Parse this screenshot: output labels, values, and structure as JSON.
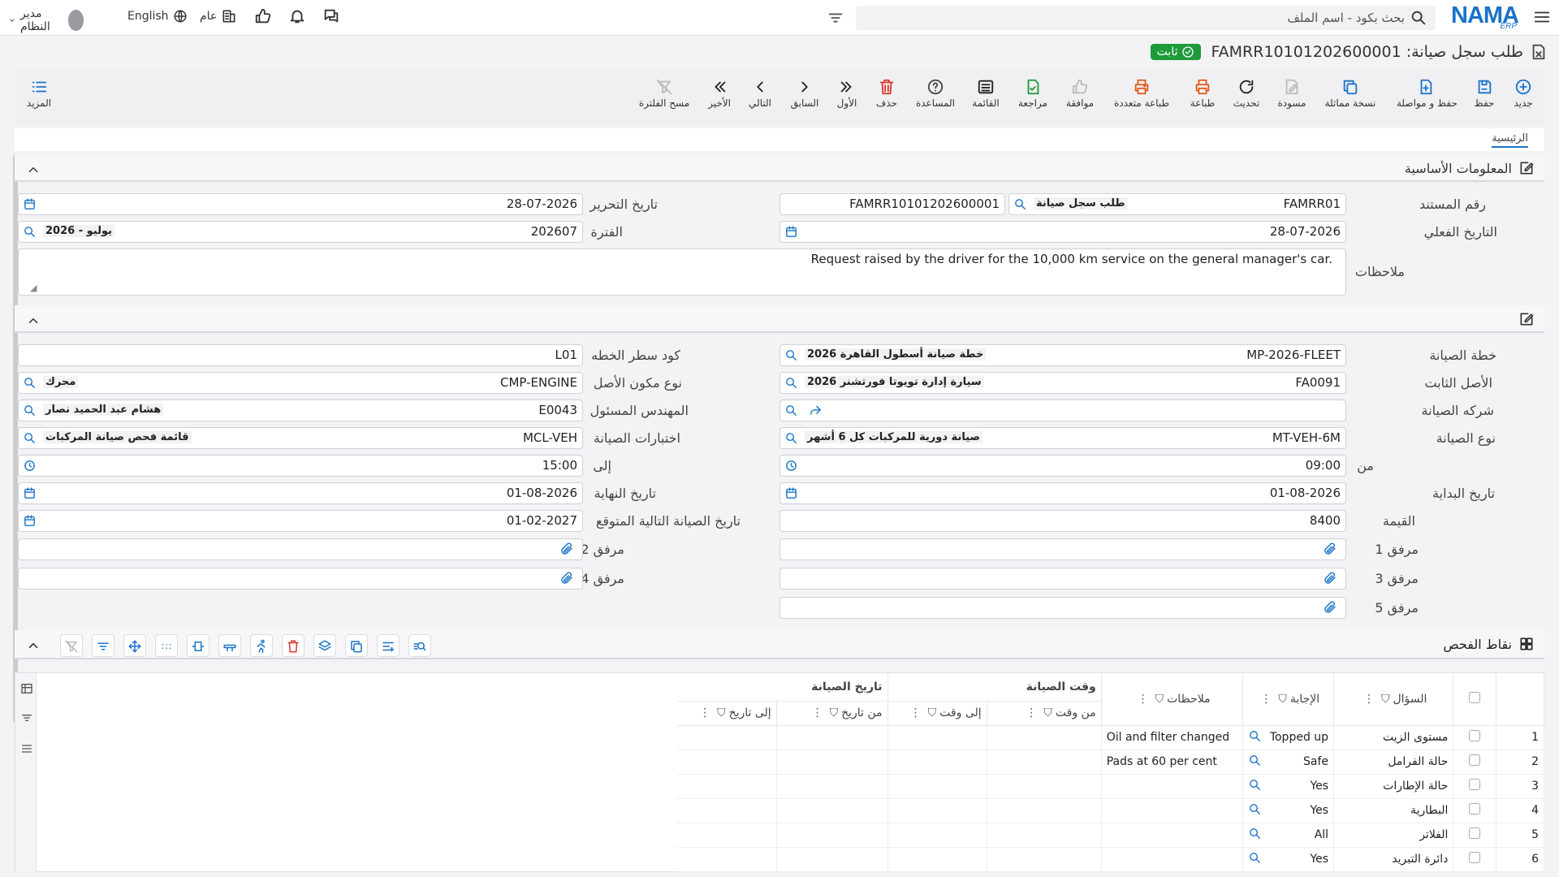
{
  "topbar": {
    "search_placeholder": "بحث بكود - اسم الملف",
    "logo_main": "NAMA",
    "logo_sub": "ERP",
    "user": "مدير النظام",
    "language": "English",
    "scope": "عام"
  },
  "title": {
    "text": "طلب سجل صيانة: FAMRR10101202600001",
    "status": "ثابت"
  },
  "toolbar": [
    {
      "label": "جديد",
      "icon": "plus-circle-icon"
    },
    {
      "label": "حفظ",
      "icon": "save-icon"
    },
    {
      "label": "حفظ و مواصلة",
      "icon": "save-continue-icon"
    },
    {
      "label": "نسخة مماثلة",
      "icon": "copy-icon"
    },
    {
      "label": "مسودة",
      "icon": "draft-icon"
    },
    {
      "label": "تحديث",
      "icon": "refresh-icon"
    },
    {
      "label": "طباعة",
      "icon": "print-icon"
    },
    {
      "label": "طباعة متعددة",
      "icon": "multi-print-icon"
    },
    {
      "label": "موافقة",
      "icon": "thumbs-up-icon"
    },
    {
      "label": "مراجعة",
      "icon": "review-icon"
    },
    {
      "label": "القائمة",
      "icon": "list-icon"
    },
    {
      "label": "المساعدة",
      "icon": "help-icon"
    },
    {
      "label": "حذف",
      "icon": "trash-icon"
    },
    {
      "label": "الأول",
      "icon": "first-icon"
    },
    {
      "label": "السابق",
      "icon": "previous-icon"
    },
    {
      "label": "التالي",
      "icon": "next-icon"
    },
    {
      "label": "الأخير",
      "icon": "last-icon"
    },
    {
      "label": "مسح الفلترة",
      "icon": "clear-filter-icon"
    }
  ],
  "more_label": "المزيد",
  "tab_main": "الرئيسية",
  "section_basic": "المعلومات الأساسية",
  "basic": {
    "doc_no_label": "رقم المستند",
    "doc_no": "FAMRR01",
    "doc_type": "طلب سجل صيانة",
    "doc_code": "FAMRR10101202600001",
    "issue_date_label": "تاريخ التحرير",
    "issue_date": "28-07-2026",
    "actual_date_label": "التاريخ الفعلي",
    "actual_date": "28-07-2026",
    "period_label": "الفترة",
    "period": "202607",
    "period_desc": "2026 - يوليو",
    "notes_label": "ملاحظات",
    "notes": "Request raised by the driver for the 10,000 km service on the general manager's car."
  },
  "details": {
    "plan_label": "خطة الصيانة",
    "plan": "MP-2026-FLEET",
    "plan_desc": "خطة صيانة أسطول القاهرة 2026",
    "plan_line_label": "كود سطر الخطه",
    "plan_line": "L01",
    "asset_label": "الأصل الثابت",
    "asset": "FA0091",
    "asset_desc": "سيارة إدارة تويوتا فورتشنر 2026",
    "component_label": "نوع مكون الأصل",
    "component": "CMP-ENGINE",
    "component_desc": "محرك",
    "company_label": "شركه الصيانة",
    "engineer_label": "المهندس المسئول",
    "engineer": "E0043",
    "engineer_desc": "هشام عبد الحميد نصار",
    "mtype_label": "نوع الصيانة",
    "mtype": "MT-VEH-6M",
    "mtype_desc": "صيانة دورية للمركبات كل 6 أشهر",
    "tests_label": "اختبارات الصيانة",
    "tests": "MCL-VEH",
    "tests_desc": "قائمة فحص صيانة المركبات",
    "from_label": "من",
    "from": "09:00",
    "to_label": "إلى",
    "to": "15:00",
    "start_label": "تاريخ البداية",
    "start": "01-08-2026",
    "end_label": "تاريخ النهاية",
    "end": "01-08-2026",
    "value_label": "القيمة",
    "value": "8400",
    "next_label": "تاريخ الصيانة التالية المتوقع",
    "next": "01-02-2027",
    "att1": "مرفق 1",
    "att2": "مرفق 2",
    "att3": "مرفق 3",
    "att4": "مرفق 4",
    "att5": "مرفق 5"
  },
  "grid": {
    "title": "نقاط الفحص",
    "group_time": "وقت الصيانة",
    "group_date": "تاريخ الصيانة",
    "columns": [
      "السؤال",
      "الإجابة",
      "ملاحظات",
      "من وقت",
      "إلى وقت",
      "من تاريخ",
      "إلى تاريخ"
    ],
    "rows": [
      {
        "n": "1",
        "q": "مستوى الزيت",
        "a": "Topped up",
        "note": "Oil and filter changed"
      },
      {
        "n": "2",
        "q": "حالة الفرامل",
        "a": "Safe",
        "note": "Pads at 60 per cent"
      },
      {
        "n": "3",
        "q": "حالة الإطارات",
        "a": "Yes",
        "note": ""
      },
      {
        "n": "4",
        "q": "البطارية",
        "a": "Yes",
        "note": ""
      },
      {
        "n": "5",
        "q": "الفلاتر",
        "a": "All",
        "note": ""
      },
      {
        "n": "6",
        "q": "دائرة التبريد",
        "a": "Yes",
        "note": ""
      }
    ]
  },
  "colors": {
    "accent": "#1a73c8",
    "status_green": "#1e9a3b",
    "delete_red": "#d9342b"
  }
}
